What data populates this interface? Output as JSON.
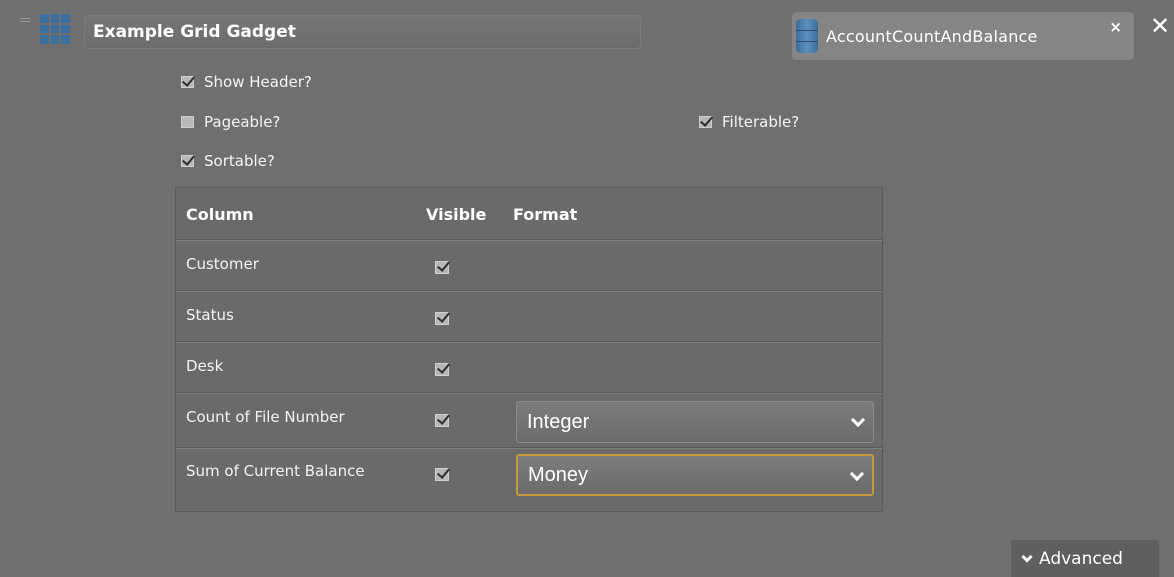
{
  "header": {
    "title": "Example Grid Gadget",
    "data_source": "AccountCountAndBalance",
    "source_close": "×",
    "gadget_close": "✕"
  },
  "options": {
    "show_header": {
      "label": "Show Header?",
      "checked": true
    },
    "pageable": {
      "label": "Pageable?",
      "checked": false
    },
    "filterable": {
      "label": "Filterable?",
      "checked": true
    },
    "sortable": {
      "label": "Sortable?",
      "checked": true
    }
  },
  "table": {
    "headers": {
      "column": "Column",
      "visible": "Visible",
      "format": "Format"
    },
    "rows": [
      {
        "column": "Customer",
        "visible": true,
        "format": ""
      },
      {
        "column": "Status",
        "visible": true,
        "format": ""
      },
      {
        "column": "Desk",
        "visible": true,
        "format": ""
      },
      {
        "column": "Count of File Number",
        "visible": true,
        "format": "Integer"
      },
      {
        "column": "Sum of Current Balance",
        "visible": true,
        "format": "Money"
      }
    ]
  },
  "advanced": {
    "label": "Advanced"
  },
  "colors": {
    "background": "#6f6f6f",
    "accent_focus": "#c99a3a",
    "icon_blue": "#3a6fa0"
  }
}
